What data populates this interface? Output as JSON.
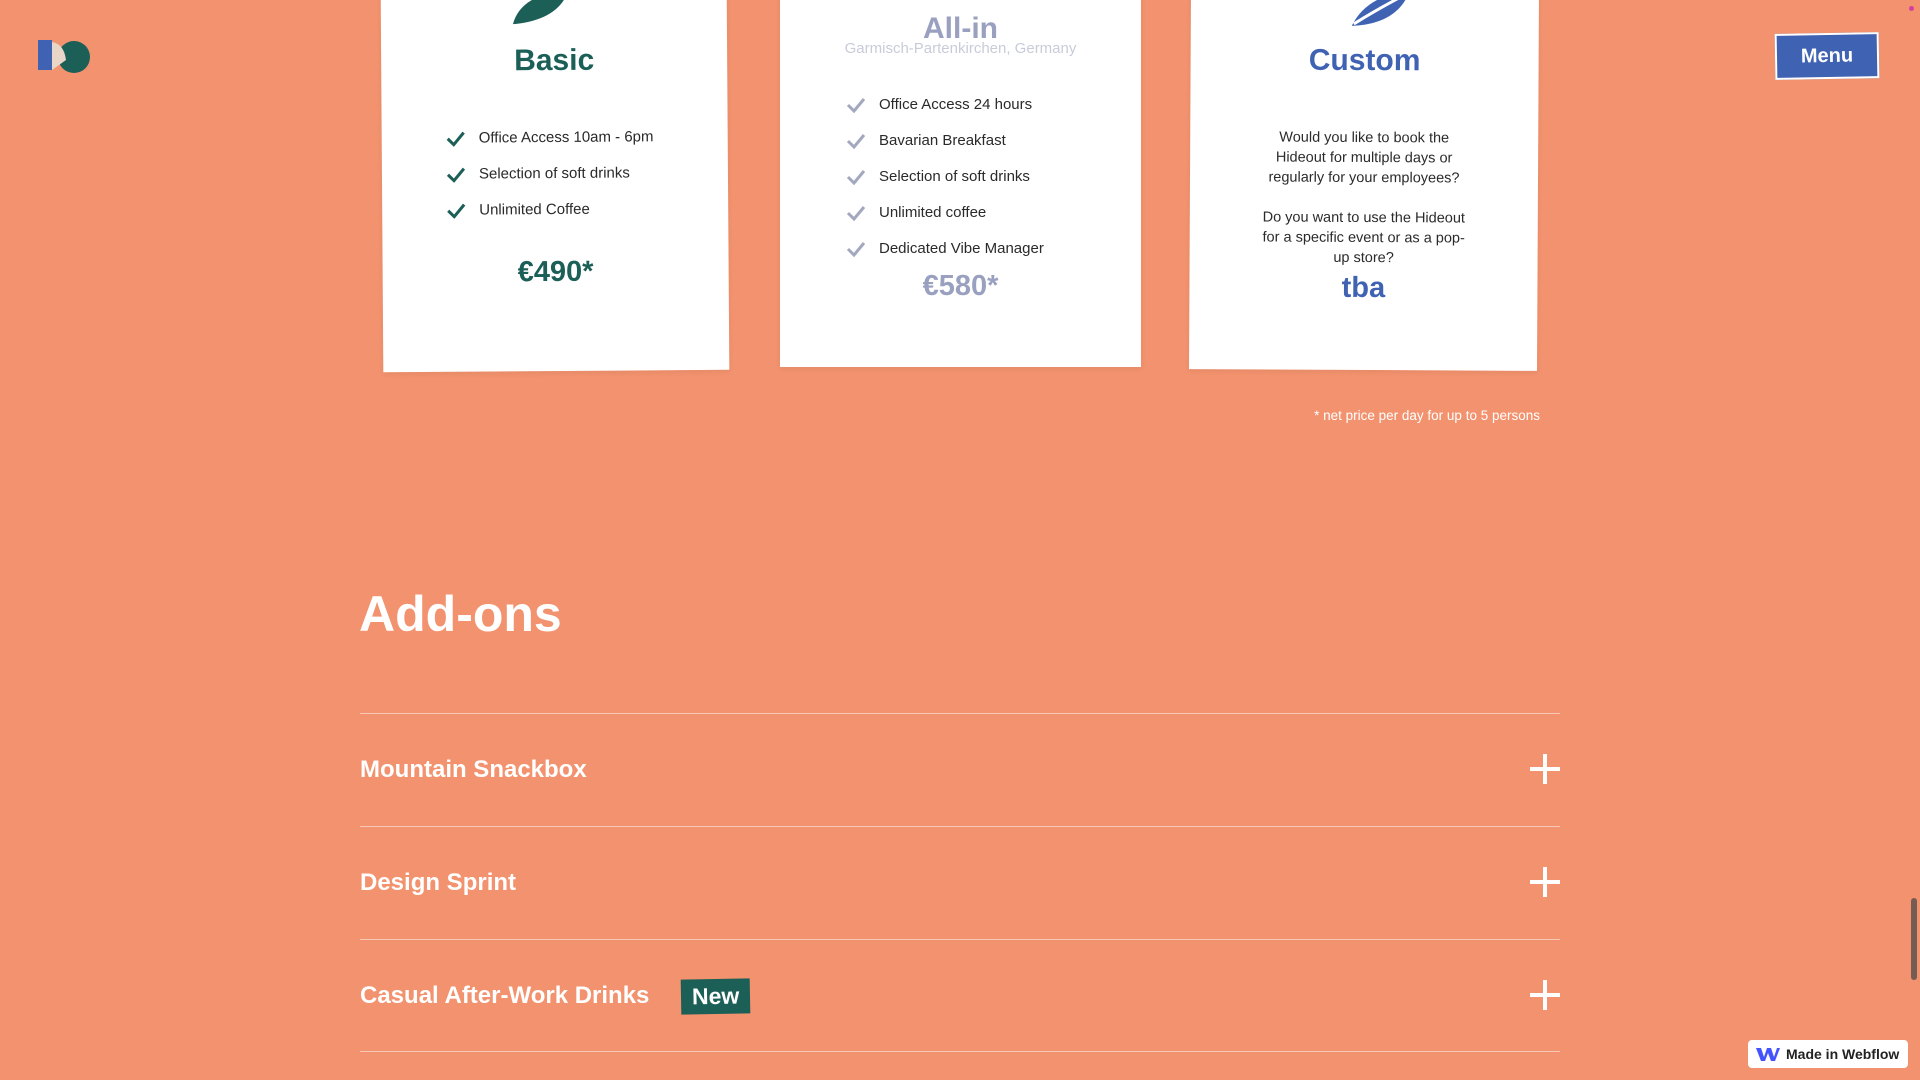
{
  "header": {
    "menu_label": "Menu",
    "logo_icon": "hideout-logo-icon"
  },
  "pricing": {
    "cards": [
      {
        "title": "Basic",
        "features": [
          "Office Access 10am - 6pm",
          "Selection of soft drinks",
          "Unlimited Coffee"
        ],
        "price": "€490*",
        "accent_color": "#1b5f57"
      },
      {
        "title": "All-in",
        "subtitle": "Garmisch-Partenkirchen, Germany",
        "features": [
          "Office Access 24 hours",
          "Bavarian Breakfast",
          "Selection of soft drinks",
          "Unlimited coffee",
          "Dedicated Vibe Manager"
        ],
        "price": "€580*",
        "accent_color": "#9aa0bf"
      },
      {
        "title": "Custom",
        "text_1": "Would you like to book the Hideout for multiple days or regularly for your employees?",
        "text_2": "Do you want to use the Hideout for a specific event or as a pop-up store?",
        "price": "tba",
        "accent_color": "#3f62b3"
      }
    ],
    "note": "* net price per day for up to 5 persons"
  },
  "addons": {
    "heading": "Add-ons",
    "items": [
      {
        "label": "Mountain Snackbox",
        "badge": ""
      },
      {
        "label": "Design Sprint",
        "badge": ""
      },
      {
        "label": "Casual After-Work Drinks",
        "badge": "New"
      }
    ]
  },
  "footer": {
    "webflow_badge": "Made in Webflow"
  },
  "colors": {
    "background": "#f2926e",
    "menu_button": "#3f62b3",
    "badge_green": "#1b5f57"
  }
}
